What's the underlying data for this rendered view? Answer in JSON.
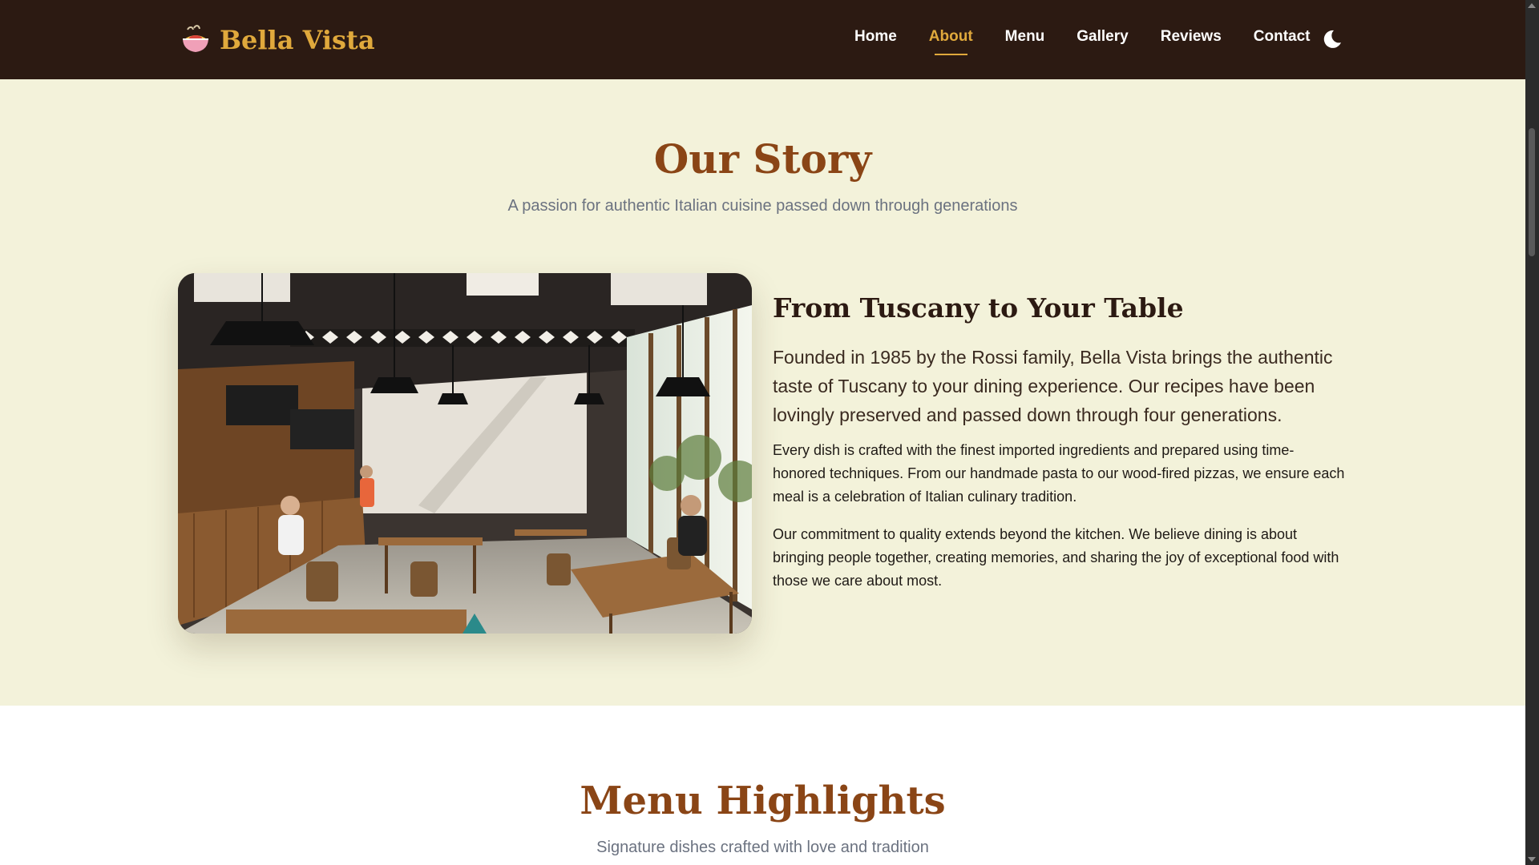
{
  "header": {
    "brand": "Bella Vista",
    "brand_icon": "pasta-bowl-icon",
    "nav": [
      {
        "label": "Home",
        "active": false
      },
      {
        "label": "About",
        "active": true
      },
      {
        "label": "Menu",
        "active": false
      },
      {
        "label": "Gallery",
        "active": false
      },
      {
        "label": "Reviews",
        "active": false
      },
      {
        "label": "Contact",
        "active": false
      }
    ],
    "theme_toggle_icon": "moon-icon"
  },
  "story": {
    "title": "Our Story",
    "subtitle": "A passion for authentic Italian cuisine passed down through generations",
    "image_icon": "restaurant-interior-photo",
    "heading": "From Tuscany to Your Table",
    "lead": "Founded in 1985 by the Rossi family, Bella Vista brings the authentic taste of Tuscany to your dining experience. Our recipes have been lovingly preserved and passed down through four generations.",
    "paragraphs": [
      "Every dish is crafted with the finest imported ingredients and prepared using time-honored techniques. From our handmade pasta to our wood-fired pizzas, we ensure each meal is a celebration of Italian culinary tradition.",
      "Our commitment to quality extends beyond the kitchen. We believe dining is about bringing people together, creating memories, and sharing the joy of exceptional food with those we care about most."
    ]
  },
  "menu": {
    "title": "Menu Highlights",
    "subtitle": "Signature dishes crafted with love and tradition"
  },
  "colors": {
    "header_bg": "#2c1a12",
    "accent": "#e0a93c",
    "section_bg": "#f3f2da",
    "title_brown": "#8a4516"
  }
}
